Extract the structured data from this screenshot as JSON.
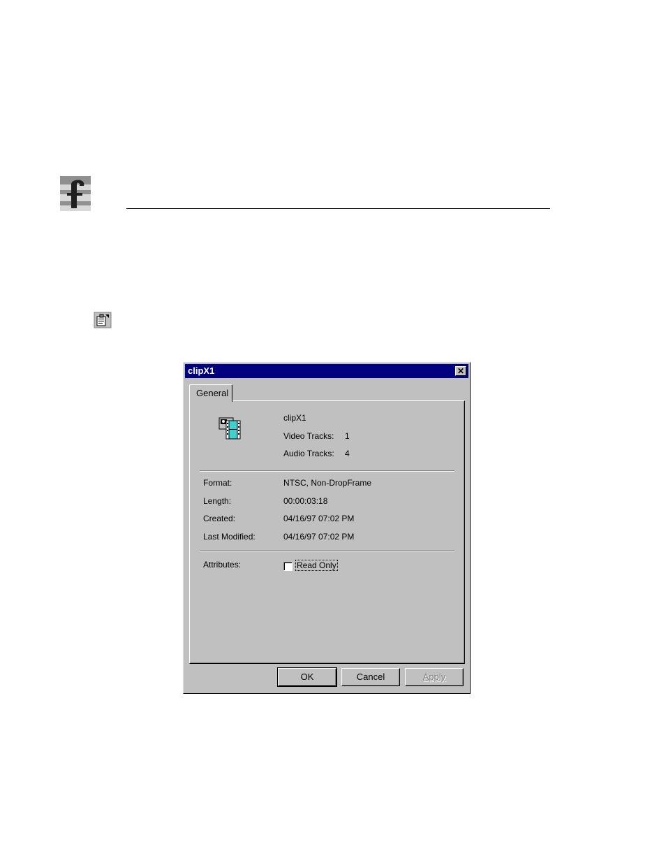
{
  "dialog": {
    "title": "clipX1",
    "close_glyph": "✕",
    "tabs": [
      {
        "label": "General"
      }
    ],
    "header": {
      "clip_name": "clipX1",
      "video_tracks_label": "Video Tracks:",
      "video_tracks_value": "1",
      "audio_tracks_label": "Audio Tracks:",
      "audio_tracks_value": "4"
    },
    "properties": [
      {
        "label": "Format:",
        "value": "NTSC, Non-DropFrame"
      },
      {
        "label": "Length:",
        "value": "00:00:03:18"
      },
      {
        "label": "Created:",
        "value": "04/16/97 07:02 PM"
      },
      {
        "label": "Last Modified:",
        "value": "04/16/97 07:02 PM"
      }
    ],
    "attributes": {
      "label": "Attributes:",
      "read_only_label": "Read Only",
      "read_only_checked": false
    },
    "buttons": {
      "ok": "OK",
      "cancel": "Cancel",
      "apply": "Apply"
    }
  },
  "icons": {
    "logo": "company-logo",
    "properties_toolbar": "properties-icon",
    "clip": "video-clip-icon"
  }
}
